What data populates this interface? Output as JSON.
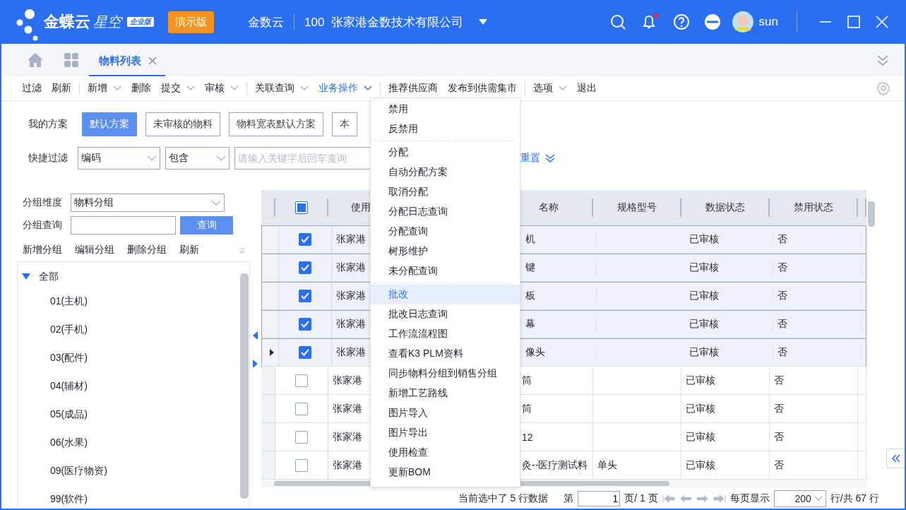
{
  "header": {
    "logo": {
      "name": "金蝶云",
      "product": "星空",
      "edition": "企业版"
    },
    "demo_badge": "演示版",
    "tenant": "金数云",
    "org_code": "100",
    "org_name": "张家港金数技术有限公司",
    "notification_dot": true,
    "user": "sun"
  },
  "tabs": [
    {
      "label": "物料列表",
      "selected": true
    }
  ],
  "toolbar": [
    [
      {
        "label": "过滤",
        "has_menu": false,
        "active": false
      },
      {
        "label": "刷新",
        "has_menu": false,
        "active": false
      }
    ],
    [
      {
        "label": "新增",
        "has_menu": true,
        "active": false
      },
      {
        "label": "删除",
        "has_menu": false,
        "active": false
      },
      {
        "label": "提交",
        "has_menu": true,
        "active": false
      },
      {
        "label": "审核",
        "has_menu": true,
        "active": false
      }
    ],
    [
      {
        "label": "关联查询",
        "has_menu": true,
        "active": false
      },
      {
        "label": "业务操作",
        "has_menu": true,
        "active": true
      }
    ],
    [
      {
        "label": "推荐供应商",
        "has_menu": false,
        "active": false
      },
      {
        "label": "发布到供需集市",
        "has_menu": false,
        "active": false
      }
    ],
    [
      {
        "label": "选项",
        "has_menu": true,
        "active": false
      },
      {
        "label": "退出",
        "has_menu": false,
        "active": false
      }
    ]
  ],
  "filter": {
    "scheme_label": "我的方案",
    "schemes": [
      {
        "label": "默认方案",
        "selected": true
      },
      {
        "label": "未审核的物料",
        "selected": false
      },
      {
        "label": "物料宽表默认方案",
        "selected": false
      },
      {
        "label": "本",
        "selected": false
      }
    ],
    "quick_label": "快捷过滤",
    "field": "编码",
    "operator": "包含",
    "placeholder": "请输入关键字后回车查询",
    "reset": "重置"
  },
  "group_panel": {
    "dimension_label": "分组维度",
    "dimension": "物料分组",
    "query_label": "分组查询",
    "query_button": "查询",
    "actions": [
      "新增分组",
      "编辑分组",
      "删除分组",
      "刷新"
    ],
    "tree": [
      {
        "label": "全部",
        "expanded": true,
        "children": [
          {
            "label": "01(主机)"
          },
          {
            "label": "02(手机)"
          },
          {
            "label": "03(配件)"
          },
          {
            "label": "04(辅材)"
          },
          {
            "label": "05(成品)"
          },
          {
            "label": "06(水果)"
          },
          {
            "label": "09(医疗物资)"
          },
          {
            "label": "99(软件)"
          }
        ]
      }
    ]
  },
  "table": {
    "select_all_partial": true,
    "columns": [
      "使用",
      "",
      "名称",
      "规格型号",
      "数据状态",
      "禁用状态"
    ],
    "rows": [
      {
        "checked": true,
        "current": false,
        "cells": [
          "张家港",
          "",
          "机",
          "",
          "已审核",
          "否"
        ]
      },
      {
        "checked": true,
        "current": false,
        "cells": [
          "张家港",
          "",
          "键",
          "",
          "已审核",
          "否"
        ]
      },
      {
        "checked": true,
        "current": false,
        "cells": [
          "张家港",
          "",
          "板",
          "",
          "已审核",
          "否"
        ]
      },
      {
        "checked": true,
        "current": false,
        "cells": [
          "张家港",
          "",
          "幕",
          "",
          "已审核",
          "否"
        ]
      },
      {
        "checked": true,
        "current": true,
        "cells": [
          "张家港",
          "",
          "像头",
          "",
          "已审核",
          "否"
        ]
      },
      {
        "checked": false,
        "current": false,
        "cells": [
          "张家港",
          "",
          "筒",
          "",
          "已审核",
          "否"
        ]
      },
      {
        "checked": false,
        "current": false,
        "cells": [
          "张家港",
          "",
          "筒",
          "",
          "已审核",
          "否"
        ]
      },
      {
        "checked": false,
        "current": false,
        "cells": [
          "张家港",
          "",
          "12",
          "",
          "已审核",
          "否"
        ]
      },
      {
        "checked": false,
        "current": false,
        "cells": [
          "张家港",
          "",
          "灸--医疗测试料",
          "单头",
          "已审核",
          "否"
        ]
      }
    ]
  },
  "pager": {
    "selection": "当前选中了 5 行数据",
    "page_prefix": "第",
    "page": "1",
    "page_suffix": "页/ 1 页",
    "per_page_label": "每页显示",
    "per_page": "200",
    "total": "行/共 67 行"
  },
  "menu": {
    "groups": [
      [
        {
          "label": "禁用",
          "selected": false
        },
        {
          "label": "反禁用",
          "selected": false
        }
      ],
      [
        {
          "label": "分配",
          "selected": false
        },
        {
          "label": "自动分配方案",
          "selected": false
        },
        {
          "label": "取消分配",
          "selected": false
        },
        {
          "label": "分配日志查询",
          "selected": false
        },
        {
          "label": "分配查询",
          "selected": false
        },
        {
          "label": "树形维护",
          "selected": false
        },
        {
          "label": "未分配查询",
          "selected": false
        }
      ],
      [
        {
          "label": "批改",
          "selected": true
        },
        {
          "label": "批改日志查询",
          "selected": false
        },
        {
          "label": "工作流流程图",
          "selected": false
        },
        {
          "label": "查看K3 PLM资料",
          "selected": false
        },
        {
          "label": "同步物料分组到销售分组",
          "selected": false
        },
        {
          "label": "新增工艺路线",
          "selected": false
        },
        {
          "label": "图片导入",
          "selected": false
        },
        {
          "label": "图片导出",
          "selected": false
        },
        {
          "label": "使用检查",
          "selected": false
        },
        {
          "label": "更新BOM",
          "selected": false
        }
      ]
    ]
  }
}
